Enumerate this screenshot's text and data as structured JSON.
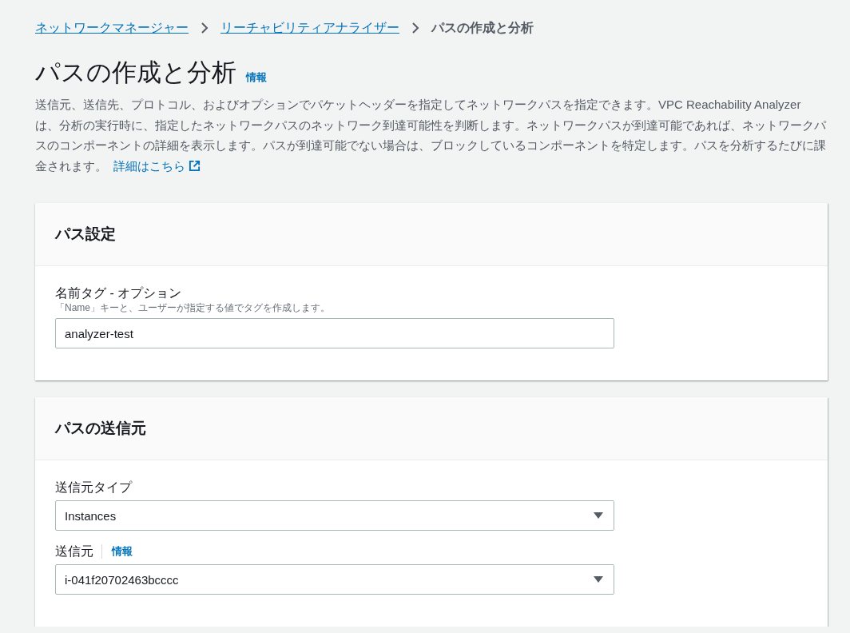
{
  "breadcrumbs": [
    {
      "label": "ネットワークマネージャー",
      "link": true
    },
    {
      "label": "リーチャビリティアナライザー",
      "link": true
    },
    {
      "label": "パスの作成と分析",
      "link": false
    }
  ],
  "header": {
    "title": "パスの作成と分析",
    "info": "情報",
    "description": "送信元、送信先、プロトコル、およびオプションでパケットヘッダーを指定してネットワークパスを指定できます。VPC Reachability Analyzer は、分析の実行時に、指定したネットワークパスのネットワーク到達可能性を判断します。ネットワークパスが到達可能であれば、ネットワークパスのコンポーネントの詳細を表示します。パスが到達可能でない場合は、ブロックしているコンポーネントを特定します。パスを分析するたびに課金されます。",
    "learn_more": "詳細はこちら"
  },
  "cards": [
    {
      "title": "パス設定",
      "fields": [
        {
          "kind": "text",
          "label": "名前タグ - オプション",
          "hint": "「Name」キーと、ユーザーが指定する値でタグを作成します。",
          "value": "analyzer-test"
        }
      ]
    },
    {
      "title": "パスの送信元",
      "fields": [
        {
          "kind": "select",
          "label": "送信元タイプ",
          "value": "Instances"
        },
        {
          "kind": "select",
          "label": "送信元",
          "info": "情報",
          "value": "i-041f20702463bcccc"
        }
      ]
    }
  ]
}
